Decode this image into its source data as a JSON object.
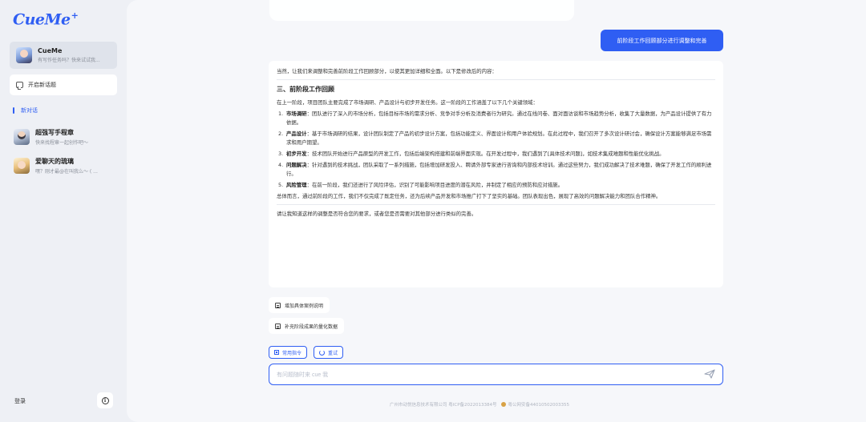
{
  "sidebar": {
    "logo": "CueMe",
    "logo_mark": "+",
    "agent": {
      "title": "CueMe",
      "subtitle": "有写作任务吗？快来试试我..."
    },
    "new_topic": "开启新话题",
    "new_chat": "新对话",
    "agents": [
      {
        "title": "超强写手程章",
        "subtitle": "快来找程章一起创作吧～"
      },
      {
        "title": "爱聊天的琉璃",
        "subtitle": "嘿？刚才最@在叫我么～ ( ..."
      }
    ],
    "login": "登录",
    "info": "i"
  },
  "chat": {
    "user_message": "前阶段工作回顾部分进行调整和完善",
    "answer": {
      "intro": "当然，让我们来调整和完善前阶段工作回顾部分，以使其更加详细和全面。以下是修改后的内容：",
      "heading": "三、前阶段工作回顾",
      "lead": "在上一阶段，项目团队主要完成了市场调研、产品设计与初步开发任务。这一阶段的工作涵盖了以下几个关键领域：",
      "items": [
        {
          "num": "1.",
          "title": "市场调研",
          "text": "：团队进行了深入的市场分析，包括目标市场的需求分析、竞争对手分析及消费者行为研究。通过在线问卷、面对面访谈和市场趋势分析，收集了大量数据，为产品设计提供了有力依据。"
        },
        {
          "num": "2.",
          "title": "产品设计",
          "text": "：基于市场调研的结果，设计团队制定了产品的初步设计方案，包括功能定义、界面设计和用户体验规划。在此过程中，我们召开了多次设计研讨会，确保设计方案能够满足市场需求和用户期望。"
        },
        {
          "num": "3.",
          "title": "初步开发",
          "text": "：技术团队开始进行产品原型的开发工作，包括后端架构搭建和前端界面实现。在开发过程中，我们遇到了[具体技术问题]，如技术集成难题和性能优化挑战。"
        },
        {
          "num": "4.",
          "title": "问题解决",
          "text": "：针对遇到的技术挑战，团队采取了一系列措施，包括增加研发投入、聘请外部专家进行咨询和内部技术培训。通过这些努力，我们成功解决了技术难题，确保了开发工作的顺利进行。"
        },
        {
          "num": "5.",
          "title": "风险管理",
          "text": "：在前一阶段，我们还进行了风险评估，识别了可能影响项目进度的潜在风险，并制定了相应的预防和应对措施。"
        }
      ],
      "summary": "总体而言，通过前阶段的工作，我们不仅完成了既定任务，还为后续产品开发和市场推广打下了坚实的基础。团队表现出色，展现了高效的问题解决能力和团队合作精神。",
      "closing": "请让我知道这样的调整是否符合您的要求，或者您是否需要对其他部分进行类似的完善。"
    },
    "suggestions": [
      "增加具体案例说明",
      "补充阶段成果的量化数据"
    ],
    "chips": {
      "commands": "常用指令",
      "retry": "重试"
    },
    "input_placeholder": "有问题随时来 cue 我",
    "footer": {
      "company": "广州市动悦信息技术有限公司 粤ICP备2022013384号",
      "police": "粤公网安备44010502003355"
    }
  },
  "colors": {
    "accent": "#2f5ef3",
    "background": "#eef0f5",
    "panel": "#ffffff"
  }
}
